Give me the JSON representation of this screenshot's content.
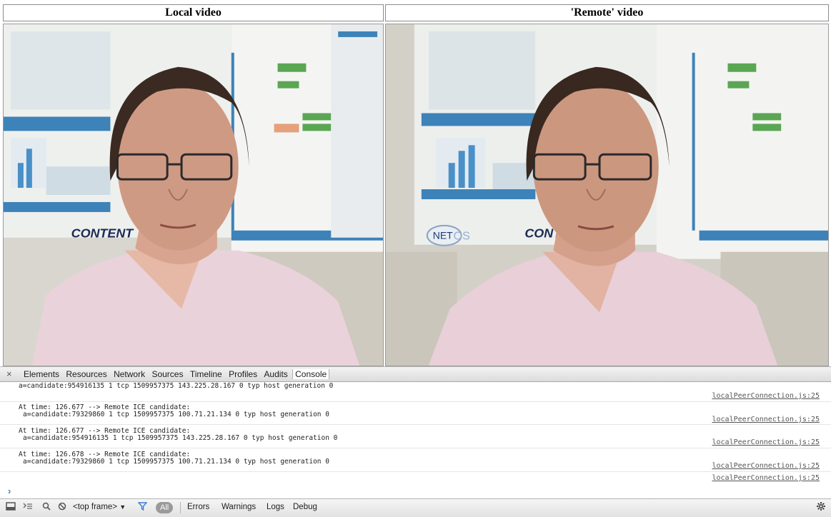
{
  "videos": {
    "local_title": "Local video",
    "remote_title": "'Remote' video",
    "poster_logo": "CONTENT",
    "poster_logo2": "NET",
    "poster_logo3": "OS"
  },
  "devtools": {
    "close_glyph": "×",
    "tabs": [
      "Elements",
      "Resources",
      "Network",
      "Sources",
      "Timeline",
      "Profiles",
      "Audits",
      "Console"
    ],
    "active_tab": "Console",
    "messages": [
      {
        "lines": [
          "a=candidate:954916135 1 tcp 1509957375 143.225.28.167 0 typ host generation 0"
        ],
        "source": "localPeerConnection.js:25"
      },
      {
        "lines": [
          "At time: 126.677 --> Remote ICE candidate:",
          "a=candidate:79329860 1 tcp 1509957375 100.71.21.134 0 typ host generation 0"
        ],
        "source": "localPeerConnection.js:25"
      },
      {
        "lines": [
          "At time: 126.677 --> Remote ICE candidate:",
          "a=candidate:954916135 1 tcp 1509957375 143.225.28.167 0 typ host generation 0"
        ],
        "source": "localPeerConnection.js:25"
      },
      {
        "lines": [
          "At time: 126.678 --> Remote ICE candidate:",
          "a=candidate:79329860 1 tcp 1509957375 100.71.21.134 0 typ host generation 0"
        ],
        "source": "localPeerConnection.js:25"
      }
    ],
    "prompt_glyph": "›",
    "statusbar": {
      "frame_select": "<top frame>",
      "all_filter": "All",
      "filters": [
        "Errors",
        "Warnings",
        "Logs",
        "Debug"
      ]
    }
  }
}
